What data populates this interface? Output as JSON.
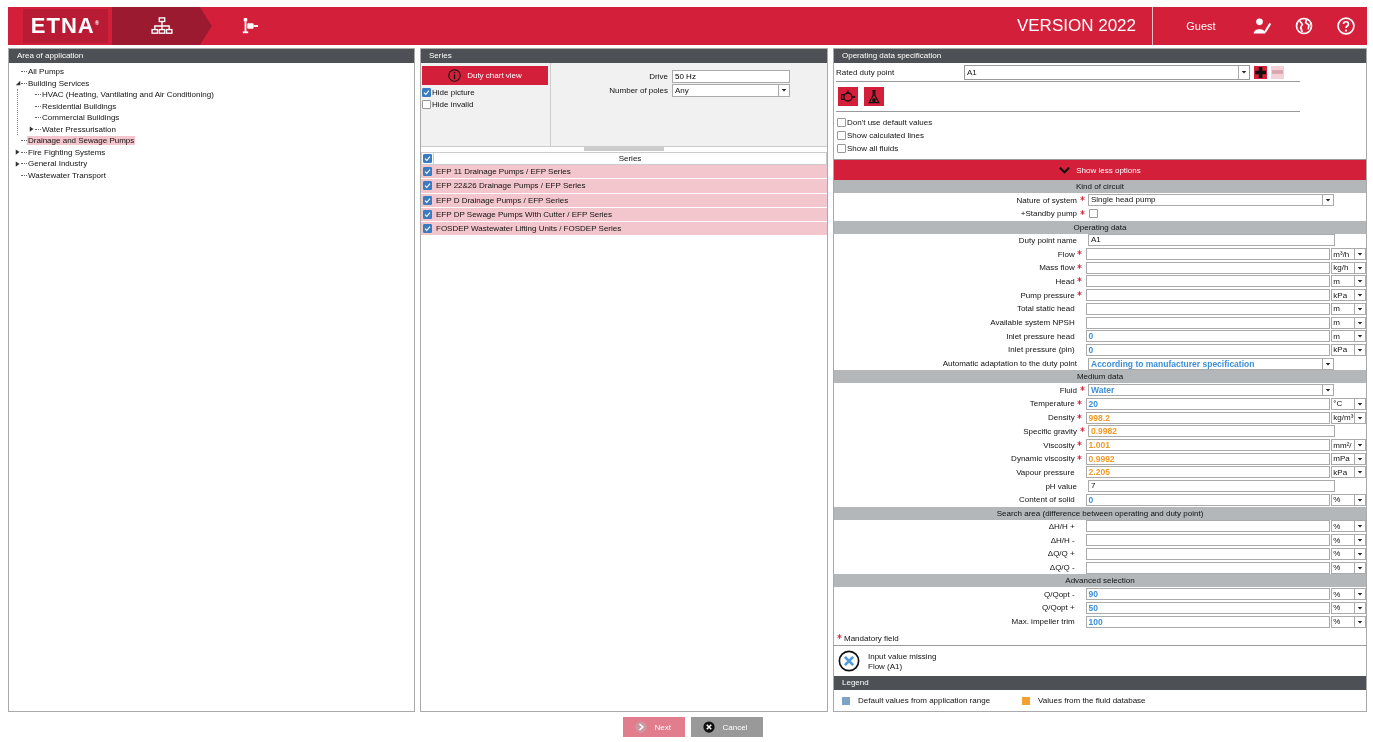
{
  "header": {
    "logo": "ETNA$^{®}$",
    "version": "VERSION 2022",
    "user": "Guest"
  },
  "breadcrumb": [
    {
      "kind": "hierarchy",
      "selected": true
    },
    {
      "kind": "pump",
      "selected": false
    }
  ],
  "tree": {
    "title": "Area of application",
    "items": [
      {
        "label": "All Pumps",
        "selected": false
      },
      {
        "label": "Building Services",
        "selected": false,
        "expanded": true,
        "children": [
          {
            "label": "HVAC (Heating, Vantilating and Air Conditioning)",
            "selected": false
          },
          {
            "label": "Residential Buildings",
            "selected": false
          },
          {
            "label": "Commercial Buildings",
            "selected": false
          },
          {
            "label": "Water Pressurisation",
            "selected": false,
            "expanded": false
          }
        ]
      },
      {
        "label": "Drainage and Sewage Pumps",
        "selected": true
      },
      {
        "label": "Fire Fighting Systems",
        "selected": false,
        "expanded": false
      },
      {
        "label": "General Industry",
        "selected": false,
        "expanded": false
      },
      {
        "label": "Wastewater Transport",
        "selected": false
      }
    ]
  },
  "series_panel": {
    "title": "Series",
    "chart_button": "Duty chart view",
    "options": [
      {
        "label": "Hide picture",
        "checked": true
      },
      {
        "label": "Hide invalid",
        "checked": false
      }
    ],
    "filters": [
      {
        "label": "Drive",
        "kind": "input",
        "value": "50 Hz"
      },
      {
        "label": "Number of poles",
        "kind": "select",
        "value": "Any"
      }
    ],
    "table": {
      "header": "Series",
      "all_checked": true,
      "rows": [
        {
          "name": "EFP 11 Drainage Pumps / EFP Series",
          "checked": true
        },
        {
          "name": "EFP 22&26 Drainage Pumps / EFP Series",
          "checked": true
        },
        {
          "name": "EFP D Drainage Pumps / EFP Series",
          "checked": true
        },
        {
          "name": "EFP DP Sewage Pumps With Cutter / EFP Series",
          "checked": true
        },
        {
          "name": "FOSDEP Wastewater Lifting Units / FOSDEP Series",
          "checked": true
        }
      ]
    }
  },
  "spec": {
    "title": "Operating data specification",
    "duty_point": {
      "label": "Rated duty point",
      "value": "A1",
      "remove_disabled": true
    },
    "options": [
      {
        "label": "Don't use default values",
        "checked": false
      },
      {
        "label": "Show calculated lines",
        "checked": false
      },
      {
        "label": "Show all fluids",
        "checked": false
      }
    ],
    "toggle": {
      "label": "Show less options",
      "expanded": true
    },
    "sections": [
      {
        "title": "Kind of circuit",
        "rows": [
          {
            "label": "Nature of system",
            "required": true,
            "kind": "select",
            "value": "Single head pump"
          },
          {
            "label": "+Standby pump",
            "required": true,
            "kind": "checkbox",
            "checked": false
          }
        ]
      },
      {
        "title": "Operating data",
        "rows": [
          {
            "label": "Duty point name",
            "required": false,
            "kind": "input",
            "value": "A1"
          },
          {
            "label": "Flow",
            "required": true,
            "kind": "input",
            "unit": "m³/h"
          },
          {
            "label": "Mass flow",
            "required": true,
            "kind": "input",
            "unit": "kg/h"
          },
          {
            "label": "Head",
            "required": true,
            "kind": "input",
            "unit": "m"
          },
          {
            "label": "Pump pressure",
            "required": true,
            "kind": "input",
            "unit": "kPa"
          },
          {
            "label": "Total static head",
            "required": false,
            "kind": "input",
            "unit": "m"
          },
          {
            "label": "Available system NPSH",
            "required": false,
            "kind": "input",
            "unit": "m"
          },
          {
            "label": "Inlet pressure head",
            "required": false,
            "kind": "input",
            "value": "0",
            "color": "#3d8fd8",
            "unit": "m"
          },
          {
            "label": "Inlet pressure (pin)",
            "required": false,
            "kind": "input",
            "value": "0",
            "color": "#3d8fd8",
            "unit": "kPa"
          },
          {
            "label": "Automatic adaptation to the duty point",
            "required": false,
            "kind": "select",
            "value": "According to manufacturer specification",
            "color": "#3d8fd8"
          }
        ]
      },
      {
        "title": "Medium data",
        "rows": [
          {
            "label": "Fluid",
            "required": true,
            "kind": "select",
            "value": "Water",
            "color": "#3d8fd8"
          },
          {
            "label": "Temperature",
            "required": true,
            "kind": "input",
            "value": "20",
            "color": "#3d8fd8",
            "unit": "°C"
          },
          {
            "label": "Density",
            "required": true,
            "kind": "input",
            "value": "998.2",
            "color": "#f29a26",
            "unit": "kg/m³"
          },
          {
            "label": "Specific gravity",
            "required": true,
            "kind": "input",
            "value": "0.9982",
            "color": "#f29a26"
          },
          {
            "label": "Viscosity",
            "required": true,
            "kind": "input",
            "value": "1.001",
            "color": "#f29a26",
            "unit": "mm²/"
          },
          {
            "label": "Dynamic viscosity",
            "required": true,
            "kind": "input",
            "value": "0.9992",
            "color": "#f29a26",
            "unit": "mPa"
          },
          {
            "label": "Vapour pressure",
            "required": false,
            "kind": "input",
            "value": "2.205",
            "color": "#f29a26",
            "unit": "kPa"
          },
          {
            "label": "pH value",
            "required": false,
            "kind": "input",
            "value": "7"
          },
          {
            "label": "Content of solid",
            "required": false,
            "kind": "input",
            "value": "0",
            "color": "#3d8fd8",
            "unit": "%"
          }
        ]
      },
      {
        "title": "Search area (difference between operating and duty point)",
        "rows": [
          {
            "label": "ΔH/H +",
            "required": false,
            "kind": "input",
            "unit": "%"
          },
          {
            "label": "ΔH/H -",
            "required": false,
            "kind": "input",
            "unit": "%"
          },
          {
            "label": "ΔQ/Q +",
            "required": false,
            "kind": "input",
            "unit": "%"
          },
          {
            "label": "ΔQ/Q -",
            "required": false,
            "kind": "input",
            "unit": "%"
          }
        ]
      },
      {
        "title": "Advanced selection",
        "rows": [
          {
            "label": "Q/Qopt -",
            "required": false,
            "kind": "input",
            "value": "90",
            "color": "#3d8fd8",
            "unit": "%"
          },
          {
            "label": "Q/Qopt +",
            "required": false,
            "kind": "input",
            "value": "50",
            "color": "#3d8fd8",
            "unit": "%"
          },
          {
            "label": "Max. impeller trim",
            "required": false,
            "kind": "input",
            "value": "100",
            "color": "#3d8fd8",
            "unit": "%"
          }
        ]
      }
    ],
    "mandatory_note": "Mandatory field",
    "message": {
      "title": "Input value missing",
      "detail": "Flow (A1)"
    },
    "legend": {
      "title": "Legend",
      "items": [
        {
          "label": "Default values from application range",
          "color": "#7fa3c2"
        },
        {
          "label": "Values from the fluid database",
          "color": "#f5a033"
        }
      ]
    }
  },
  "buttons": [
    {
      "label": "Next",
      "kind": "next",
      "disabled": true
    },
    {
      "label": "Cancel",
      "kind": "cancel",
      "disabled": false
    }
  ]
}
